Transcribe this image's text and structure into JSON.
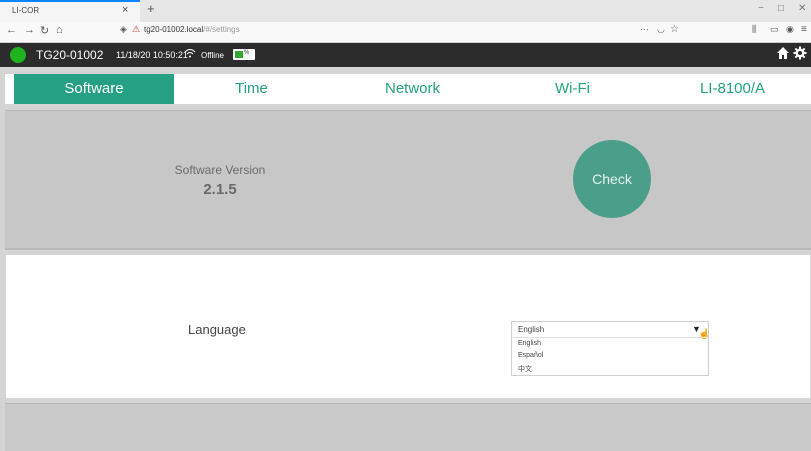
{
  "browser": {
    "tab_title": "LI-COR",
    "tab_close": "×",
    "new_tab": "+",
    "url_host": "tg20-01002.local",
    "url_path": "/#/settings",
    "win_controls": [
      "−",
      "□",
      "✕"
    ]
  },
  "status": {
    "device_id": "TG20-01002",
    "timestamp": "11/18/20 10:50:21",
    "connection": "Offline",
    "battery_level": 0.45,
    "battery_label": "%"
  },
  "tabs": [
    {
      "label": "Software",
      "active": true
    },
    {
      "label": "Time",
      "active": false
    },
    {
      "label": "Network",
      "active": false
    },
    {
      "label": "Wi-Fi",
      "active": false
    },
    {
      "label": "LI-8100/A",
      "active": false
    }
  ],
  "software": {
    "version_label": "Software Version",
    "version_value": "2.1.5",
    "check_label": "Check"
  },
  "language": {
    "label": "Language",
    "selected": "English",
    "options": [
      "English",
      "Español",
      "中文"
    ]
  },
  "colors": {
    "accent": "#25a085",
    "check_button": "#4a9e8a",
    "status_online": "#1fb31f",
    "appbar": "#2c2c2c"
  }
}
